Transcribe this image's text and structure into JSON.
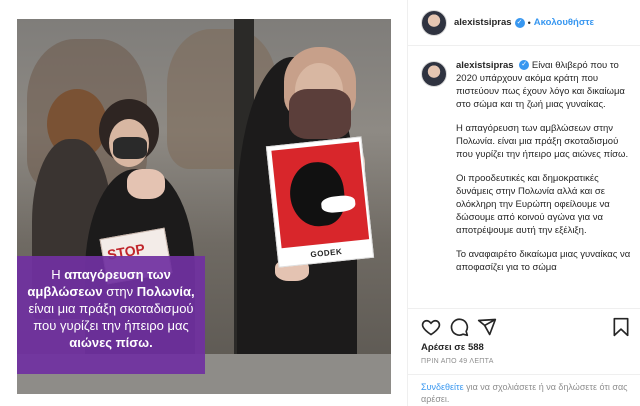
{
  "post": {
    "caption_overlay": {
      "p1": "Η ",
      "b1": "απαγόρευση των αμβλώσεων",
      "p2": " στην ",
      "b2": "Πολωνία,",
      "p3": " είναι μια πράξη σκοταδισμού που γυρίζει την ήπειρο μας ",
      "b3": "αιώνες πίσω."
    },
    "sign_text": "GODEK",
    "stop_sign_text": "STOP"
  },
  "header": {
    "username": "alexistsipras",
    "verified_glyph": "✓",
    "separator": "•",
    "follow_label": "Ακολουθήστε"
  },
  "comment": {
    "username": "alexistsipras",
    "verified_glyph": "✓",
    "para1": "Είναι θλιβερό που το 2020 υπάρχουν ακόμα κράτη που πιστεύουν πως έχουν λόγο και δικαίωμα στο σώμα και τη ζωή μιας γυναίκας.",
    "para2": "Η απαγόρευση των αμβλώσεων στην Πολωνία. είναι μια πράξη σκοταδισμού που γυρίζει την ήπειρο μας αιώνες πίσω.",
    "para3": "Οι προοδευτικές και δημοκρατικές δυνάμεις στην Πολωνία αλλά και σε ολόκληρη την Ευρώπη οφείλουμε να δώσουμε από κοινού αγώνα για να αποτρέψουμε αυτή την εξέλιξη.",
    "para4": "Το αναφαιρέτο δικαίωμα μιας γυναίκας να αποφασίζει για το σώμα"
  },
  "actions": {
    "icons": [
      "heart-icon",
      "comment-icon",
      "share-icon",
      "bookmark-icon"
    ],
    "likes": "Αρέσει σε 588",
    "time": "ΠΡΙΝ ΑΠΟ 49 ΛΕΠΤΑ"
  },
  "login_bar": {
    "link": "Συνδεθείτε",
    "text": " για να σχολιάσετε ή να δηλώσετε ότι σας αρέσει."
  },
  "colors": {
    "accent": "#3897f0",
    "overlay_purple": "#7030a0",
    "sign_red": "#d8262b"
  }
}
